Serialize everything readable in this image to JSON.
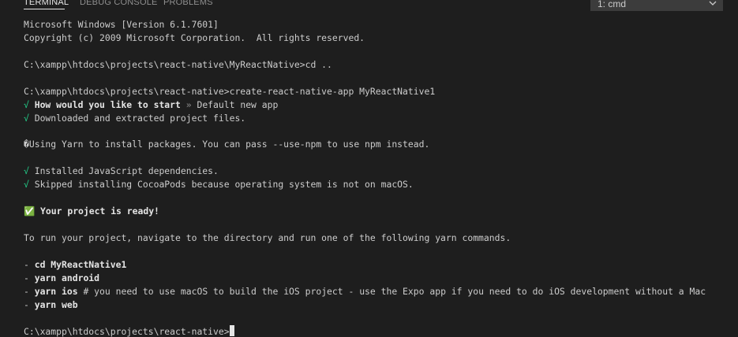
{
  "tabs": [
    {
      "label": "TERMINAL",
      "active": true
    },
    {
      "label": "DEBUG CONSOLE",
      "active": false
    },
    {
      "label": "PROBLEMS",
      "active": false
    }
  ],
  "terminal_select": {
    "selected": "1: cmd"
  },
  "colors": {
    "background": "#1e1e1e",
    "text": "#cccccc",
    "check": "#23d18b",
    "active_tab": "#e7e7e7",
    "inactive_tab": "#8f8f8f"
  },
  "icons": {
    "select_chevron": "chevron-down-icon"
  },
  "terminal": {
    "line_01": "Microsoft Windows [Version 6.1.7601]",
    "line_02": "Copyright (c) 2009 Microsoft Corporation.  All rights reserved.",
    "line_03": "C:\\xampp\\htdocs\\projects\\react-native\\MyReactNative>cd ..",
    "line_04": "C:\\xampp\\htdocs\\projects\\react-native>create-react-native-app MyReactNative1",
    "line_05_check": "√",
    "line_05_question": " How would you like to start",
    "line_05_arrow": " » ",
    "line_05_answer": "Default new app",
    "line_06_check": "√",
    "line_06_text": " Downloaded and extracted project files.",
    "line_07": "�Using Yarn to install packages. You can pass --use-npm to use npm instead.",
    "line_08_check": "√",
    "line_08_text": " Installed JavaScript dependencies.",
    "line_09_check": "√",
    "line_09_text": " Skipped installing CocoaPods because operating system is not on macOS.",
    "line_10_icon": "✅",
    "line_10_text": " Your project is ready!",
    "line_11": "To run your project, navigate to the directory and run one of the following yarn commands.",
    "line_12_dash": "- ",
    "line_12_cmd": "cd MyReactNative1",
    "line_13_dash": "- ",
    "line_13_cmd": "yarn android",
    "line_14_dash": "- ",
    "line_14_cmd": "yarn ios",
    "line_14_note": " # you need to use macOS to build the iOS project - use the Expo app if you need to do iOS development without a Mac",
    "line_15_dash": "- ",
    "line_15_cmd": "yarn web",
    "prompt": "C:\\xampp\\htdocs\\projects\\react-native>"
  }
}
